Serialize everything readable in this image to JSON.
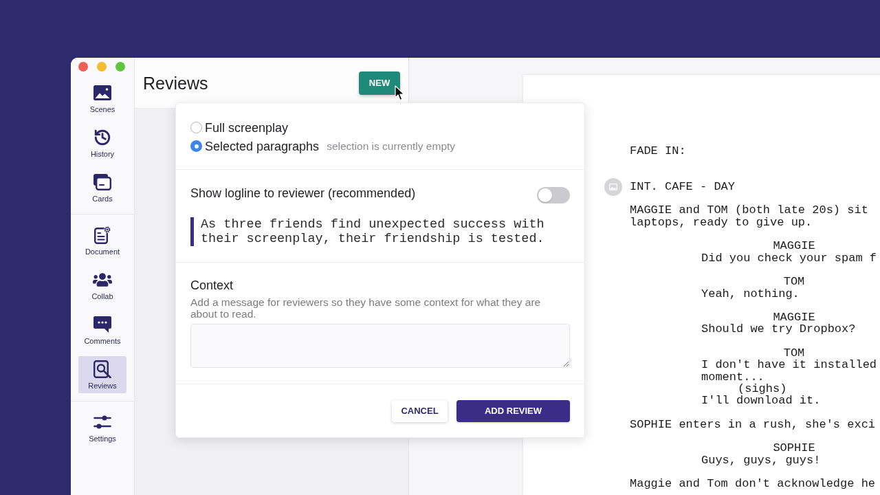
{
  "sidebar": {
    "groups": [
      {
        "items": [
          {
            "label": "Scenes",
            "selected": false
          },
          {
            "label": "History",
            "selected": false
          },
          {
            "label": "Cards",
            "selected": false
          }
        ]
      },
      {
        "items": [
          {
            "label": "Document",
            "selected": false
          },
          {
            "label": "Collab",
            "selected": false
          },
          {
            "label": "Comments",
            "selected": false
          },
          {
            "label": "Reviews",
            "selected": true
          }
        ]
      },
      {
        "items": [
          {
            "label": "Settings",
            "selected": false
          }
        ]
      }
    ]
  },
  "reviews_panel": {
    "title": "Reviews",
    "new_button": "NEW"
  },
  "new_review_popover": {
    "scope_options": [
      {
        "label": "Full screenplay",
        "selected": false
      },
      {
        "label": "Selected paragraphs",
        "selected": true,
        "note": "selection is currently empty"
      }
    ],
    "logline": {
      "label": "Show logline to reviewer (recommended)",
      "on": false,
      "text": "As three friends find unexpected success with their screenplay, their friendship is tested."
    },
    "context": {
      "label": "Context",
      "description": "Add a message for reviewers so they have some context for what they are about to read."
    },
    "buttons": [
      {
        "label": "CANCEL",
        "kind": "secondary"
      },
      {
        "label": "ADD REVIEW",
        "kind": "primary"
      }
    ]
  },
  "script": {
    "elements": [
      {
        "kind": "transition",
        "lines": [
          "FADE IN:"
        ]
      },
      {
        "kind": "scene_heading",
        "lines": [
          "INT. CAFE - DAY"
        ]
      },
      {
        "kind": "action",
        "lines": [
          "MAGGIE and TOM (both late 20s) sit",
          "laptops, ready to give up."
        ]
      },
      {
        "kind": "character",
        "lines": [
          "MAGGIE"
        ]
      },
      {
        "kind": "dialogue",
        "lines": [
          "Did you check your spam f"
        ]
      },
      {
        "kind": "character",
        "lines": [
          "TOM"
        ]
      },
      {
        "kind": "dialogue",
        "lines": [
          "Yeah, nothing."
        ]
      },
      {
        "kind": "character",
        "lines": [
          "MAGGIE"
        ]
      },
      {
        "kind": "dialogue",
        "lines": [
          "Should we try Dropbox?"
        ]
      },
      {
        "kind": "character",
        "lines": [
          "TOM"
        ]
      },
      {
        "kind": "dialogue",
        "lines": [
          "I don't have it installed",
          "moment..."
        ]
      },
      {
        "kind": "parenthetical",
        "lines": [
          "(sighs)"
        ]
      },
      {
        "kind": "dialogue",
        "lines": [
          "I'll download it."
        ]
      },
      {
        "kind": "action",
        "lines": [
          "SOPHIE enters in a rush, she's exci"
        ]
      },
      {
        "kind": "character",
        "lines": [
          "SOPHIE"
        ]
      },
      {
        "kind": "dialogue",
        "lines": [
          "Guys, guys, guys!"
        ]
      },
      {
        "kind": "action",
        "lines": [
          "Maggie and Tom don't acknowledge he"
        ]
      }
    ]
  }
}
